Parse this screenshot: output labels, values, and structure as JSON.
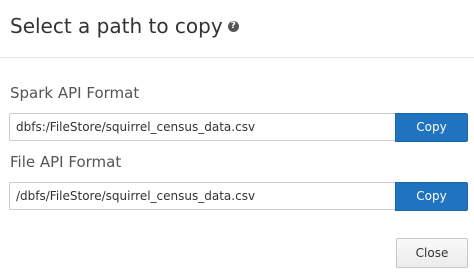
{
  "dialog": {
    "title": "Select a path to copy",
    "help_icon": "?"
  },
  "spark": {
    "label": "Spark API Format",
    "path": "dbfs:/FileStore/squirrel_census_data.csv",
    "copy_label": "Copy"
  },
  "file": {
    "label": "File API Format",
    "path": "/dbfs/FileStore/squirrel_census_data.csv",
    "copy_label": "Copy"
  },
  "footer": {
    "close_label": "Close"
  },
  "colors": {
    "primary_button": "#1f73bf",
    "text": "#333333",
    "divider": "#e5e5e5"
  },
  "icons": {
    "help": "question-circle-icon"
  }
}
